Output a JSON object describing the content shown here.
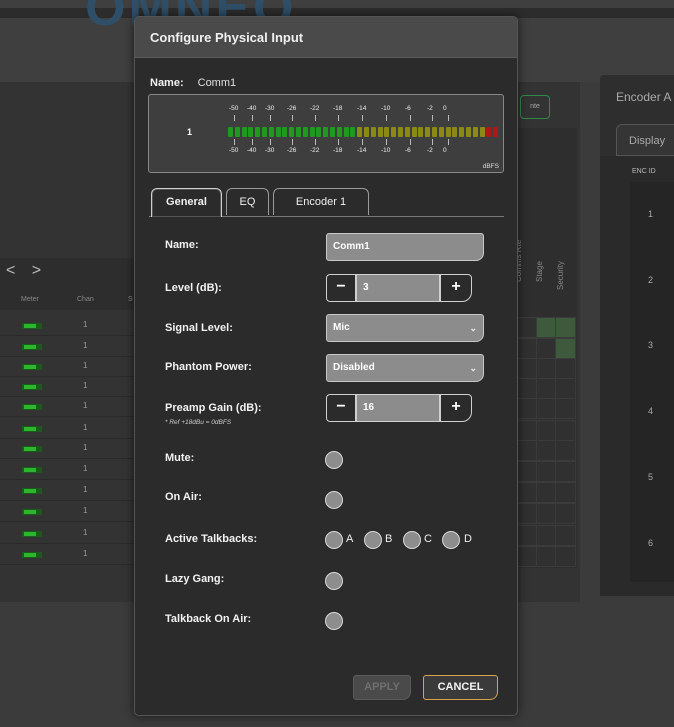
{
  "background": {
    "logo_text": "OMNEO",
    "partial_button": "nte",
    "nav_arrows": "< >",
    "columns": [
      "Meter",
      "Chan",
      "S"
    ],
    "row_chan_value": "1",
    "vertical_labels": [
      "Comms Rte",
      "Stage",
      "Security"
    ],
    "encoder_panel": {
      "title": "Encoder A",
      "tab": "Display",
      "col_header": "ENC ID",
      "ids": [
        "1",
        "2",
        "3",
        "4",
        "5",
        "6"
      ]
    }
  },
  "dialog": {
    "title": "Configure Physical Input",
    "name_label": "Name:",
    "name_value": "Comm1",
    "meter": {
      "channel": "1",
      "scale": [
        "-50",
        "-40",
        "-30",
        "-26",
        "-22",
        "-18",
        "-14",
        "-10",
        "-6",
        "-2",
        "0"
      ],
      "unit": "dBFS",
      "colors": {
        "green": "#1f9a1f",
        "yellow": "#8a8a14",
        "red": "#b01818"
      }
    },
    "tabs": [
      {
        "label": "General",
        "active": true
      },
      {
        "label": "EQ",
        "active": false
      },
      {
        "label": "Encoder 1",
        "active": false
      }
    ],
    "fields": {
      "name": {
        "label": "Name:",
        "value": "Comm1"
      },
      "level": {
        "label": "Level (dB):",
        "value": "3",
        "minus": "−",
        "plus": "+"
      },
      "signal_level": {
        "label": "Signal Level:",
        "value": "Mic"
      },
      "phantom_power": {
        "label": "Phantom Power:",
        "value": "Disabled"
      },
      "preamp_gain": {
        "label": "Preamp Gain (dB):",
        "value": "16",
        "note": "* Ref +18dBu = 0dBFS",
        "minus": "−",
        "plus": "+"
      },
      "mute": {
        "label": "Mute:"
      },
      "on_air": {
        "label": "On Air:"
      },
      "active_talkbacks": {
        "label": "Active Talkbacks:",
        "options": [
          "A",
          "B",
          "C",
          "D"
        ]
      },
      "lazy_gang": {
        "label": "Lazy Gang:"
      },
      "talkback_on_air": {
        "label": "Talkback On Air:"
      }
    },
    "buttons": {
      "apply": "APPLY",
      "cancel": "CANCEL"
    },
    "accent_color": "#d9a24c"
  }
}
